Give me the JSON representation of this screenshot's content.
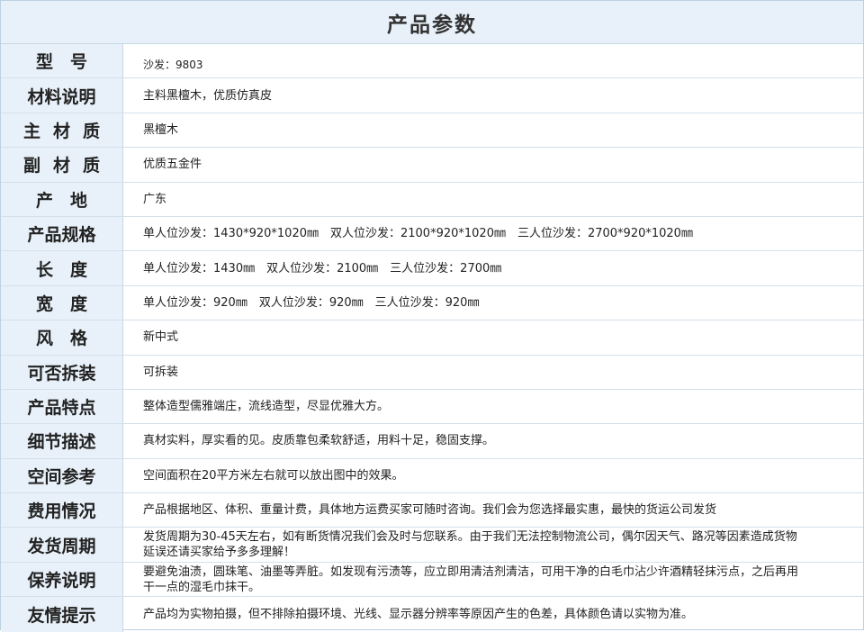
{
  "title": "产品参数",
  "rows": [
    {
      "label": "型　号",
      "value": "沙发：9803"
    },
    {
      "label": "材料说明",
      "value": "主料黑檀木，优质仿真皮"
    },
    {
      "label": "主材质",
      "value": "黑檀木"
    },
    {
      "label": "副材质",
      "value": "优质五金件"
    },
    {
      "label": "产　地",
      "value": "广东"
    },
    {
      "label": "产品规格",
      "value": "单人位沙发：1430*920*1020㎜　双人位沙发：2100*920*1020㎜　三人位沙发：2700*920*1020㎜"
    },
    {
      "label": "长　度",
      "value": "单人位沙发：1430㎜　双人位沙发：2100㎜　三人位沙发：2700㎜"
    },
    {
      "label": "宽　度",
      "value": "单人位沙发：920㎜　双人位沙发：920㎜　三人位沙发：920㎜"
    },
    {
      "label": "风　格",
      "value": "新中式"
    },
    {
      "label": "可否拆装",
      "value": "可拆装"
    },
    {
      "label": "产品特点",
      "value": "整体造型儒雅端庄，流线造型，尽显优雅大方。"
    },
    {
      "label": "细节描述",
      "value": "真材实料，厚实看的见。皮质靠包柔软舒适，用料十足，稳固支撑。"
    },
    {
      "label": "空间参考",
      "value": "空间面积在20平方米左右就可以放出图中的效果。"
    },
    {
      "label": "费用情况",
      "value": "产品根据地区、体积、重量计费，具体地方运费买家可随时咨询。我们会为您选择最实惠，最快的货运公司发货"
    },
    {
      "label": "发货周期",
      "value": "发货周期为30-45天左右，如有断货情况我们会及时与您联系。由于我们无法控制物流公司，偶尔因天气、路况等因素造成货物延误还请买家给予多多理解！"
    },
    {
      "label": "保养说明",
      "value": "要避免油渍，圆珠笔、油墨等弄脏。如发现有污渍等，应立即用清洁剂清洁，可用干净的白毛巾沾少许酒精轻抹污点，之后再用干一点的湿毛巾抹干。"
    },
    {
      "label": "友情提示",
      "value": "产品均为实物拍摄，但不排除拍摄环境、光线、显示器分辨率等原因产生的色差，具体颜色请以实物为准。"
    }
  ]
}
